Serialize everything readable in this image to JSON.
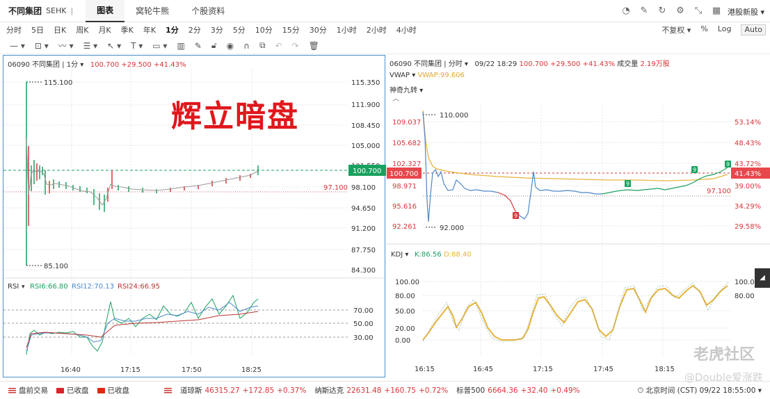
{
  "topbar": {
    "stock_name": "不同集团",
    "exchange": "SEHK",
    "separator": "|",
    "tabs": [
      {
        "label": "图表",
        "active": true
      },
      {
        "label": "窝轮牛熊",
        "active": false
      },
      {
        "label": "个股资料",
        "active": false
      }
    ],
    "icons": [
      "speedometer-icon",
      "edit-icon",
      "refresh-icon",
      "settings-icon",
      "fullscreen-icon",
      "grid-icon"
    ],
    "hk_new_stock": "港股新股 ▾"
  },
  "periods": [
    "分时",
    "5日",
    "日K",
    "周K",
    "月K",
    "季K",
    "年K",
    "1分",
    "2分",
    "3分",
    "5分",
    "10分",
    "15分",
    "30分",
    "1小时",
    "2小时",
    "4小时"
  ],
  "active_period": "1分",
  "right_options": {
    "adjust": "不复权 ▾",
    "percent": "%",
    "log": "Log",
    "auto": "Auto"
  },
  "left_chart": {
    "header": {
      "code_name": "06090  不同集团 | 1分  ▾",
      "price": "100.700",
      "change": "+29.500",
      "pct": "+41.43%"
    },
    "title_overlay": "辉立暗盘",
    "price_axis": [
      "115.350",
      "111.900",
      "108.450",
      "105.000",
      "101.550",
      "98.100",
      "94.650",
      "91.200",
      "87.750",
      "84.300"
    ],
    "high_label": "115.100",
    "low_label": "85.100",
    "current_price_tag": "100.700",
    "ref_price": "97.100",
    "rsi_header": {
      "name": "RSI",
      "rsi6": "RSI6:66.80",
      "rsi12": "RSI12:70.13",
      "rsi24": "RSI24:66.95"
    },
    "rsi_axis": [
      "70.00",
      "50.00",
      "30.00"
    ],
    "time_axis": [
      "16:40",
      "17:15",
      "17:50",
      "18:25"
    ]
  },
  "right_chart": {
    "header": {
      "code_name": "06090  不同集团 | 分时  ▾",
      "datetime": "09/22 18:29",
      "price": "100.700",
      "change": "+29.500",
      "pct": "+41.43%",
      "vol_label": "成交量",
      "vol": "2.19万股"
    },
    "vwap_label": "VWAP ▾",
    "vwap_value": "VWAP:99.606",
    "shenqi": "神奇九转 ▾",
    "price_axis_left": [
      "109.037",
      "105.682",
      "102.327",
      "98.971",
      "95.616",
      "92.261"
    ],
    "pct_axis_right": [
      "53.14%",
      "48.43%",
      "43.72%",
      "39.00%",
      "34.29%",
      "29.58%"
    ],
    "high_label": "110.000",
    "low_label": "92.000",
    "current_price_tag": "100.700",
    "current_pct_tag": "41.43%",
    "ref_price": "97.100",
    "kdj_header": {
      "name": "KDJ ▾",
      "k": "K:86.56",
      "d": "D:88.40"
    },
    "kdj_axis": [
      "100.00",
      "80.00",
      "50.00",
      "20.00",
      "0.00"
    ],
    "time_axis": [
      "16:15",
      "16:45",
      "17:15",
      "17:45",
      "18:15"
    ]
  },
  "statusbar": {
    "items": [
      {
        "flag": "us",
        "text": "盘前交易"
      },
      {
        "flag": "hk",
        "text": "已收盘"
      },
      {
        "flag": "cn",
        "text": "已收盘"
      }
    ],
    "indices": [
      {
        "name": "道琼斯",
        "value": "46315.27",
        "change": "+172.85",
        "pct": "+0.37%"
      },
      {
        "name": "纳斯达克",
        "value": "22631.48",
        "change": "+160.75",
        "pct": "+0.72%"
      },
      {
        "name": "标普500",
        "value": "6664.36",
        "change": "+32.40",
        "pct": "+0.49%"
      }
    ],
    "time": "北京时间 (CST) 09/22 18:55:00 ▾"
  },
  "watermarks": {
    "tiger": "老虎社区",
    "author": "@Double爱涨跌"
  },
  "colors": {
    "up": "#d9343a",
    "down": "#19a15f",
    "line": "#4d87c7",
    "vwap": "#e8b33c",
    "kdj": "#e8b33c",
    "accent": "#4a90c8"
  }
}
